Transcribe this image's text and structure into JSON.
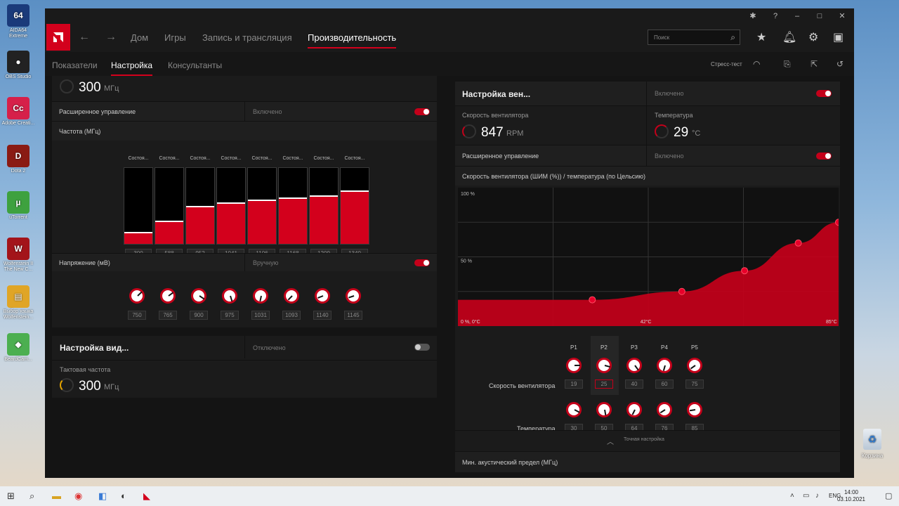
{
  "desktop": {
    "icons": [
      {
        "label": "AIDA64 Extreme",
        "glyph": "64",
        "color": "#1a3a7a"
      },
      {
        "label": "OBS Studio",
        "glyph": "●",
        "color": "#222"
      },
      {
        "label": "Adobe Creati...",
        "glyph": "Cc",
        "color": "#d6204a"
      },
      {
        "label": "Dota 2",
        "glyph": "D",
        "color": "#8a1b14"
      },
      {
        "label": "uTorrent",
        "glyph": "µ",
        "color": "#3ea13f"
      },
      {
        "label": "Wolfenstein II The New C...",
        "glyph": "W",
        "color": "#a3141a"
      },
      {
        "label": "Выбор языка Wolfenstein...",
        "glyph": "▤",
        "color": "#e0a526"
      },
      {
        "label": "BeardCam...",
        "glyph": "◆",
        "color": "#4caf50"
      }
    ],
    "recycle_bin": "Корзина"
  },
  "nav": {
    "items": [
      "Дом",
      "Игры",
      "Запись и трансляция",
      "Производительность"
    ],
    "active_index": 3,
    "search_placeholder": "Поиск"
  },
  "subnav": {
    "items": [
      "Показатели",
      "Настройка",
      "Консультанты"
    ],
    "active_index": 1,
    "stress_test": "Стресс-тест"
  },
  "gpu": {
    "top_clock_value": "300",
    "top_clock_unit": "МГц",
    "advanced_label": "Расширенное управление",
    "advanced_state": "Включено",
    "freq_label": "Частота (МГц)",
    "state_label": "Состоя...",
    "freq_values": [
      300,
      588,
      952,
      1041,
      1106,
      1168,
      1209,
      1340
    ],
    "freq_max": 1900,
    "voltage_label": "Напряжение (мВ)",
    "voltage_state": "Вручную",
    "voltage_values": [
      750,
      765,
      900,
      975,
      1031,
      1093,
      1140,
      1145
    ]
  },
  "vram": {
    "title": "Настройка вид...",
    "state": "Отключено",
    "clock_label": "Тактовая частота",
    "clock_value": "300",
    "clock_unit": "МГц"
  },
  "fan": {
    "title": "Настройка вен...",
    "state": "Включено",
    "speed_label": "Скорость вентилятора",
    "speed_value": "847",
    "speed_unit": "RPM",
    "temp_label": "Температура",
    "temp_value": "29",
    "temp_unit": "°C",
    "advanced_label": "Расширенное управление",
    "advanced_state": "Включено",
    "curve_label": "Скорость вентилятора (ШИМ (%)) / температура (по Цельсию)",
    "fine_tune": "Точная настройка",
    "acoustic_label": "Мин. акустический предел (МГц)",
    "points": [
      "P1",
      "P2",
      "P3",
      "P4",
      "P5"
    ],
    "speed_row_label": "Скорость вентилятора",
    "temp_row_label": "Температура",
    "speeds": [
      19,
      25,
      40,
      60,
      75
    ],
    "temps": [
      30,
      50,
      64,
      76,
      85
    ],
    "selected_index": 1
  },
  "chart_data": {
    "type": "area",
    "x": [
      0,
      30,
      50,
      64,
      76,
      85
    ],
    "values": [
      19,
      19,
      25,
      40,
      60,
      75
    ],
    "ytick_labels": [
      "100 %",
      "50 %",
      "0 %, 0°C"
    ],
    "xtick_labels": [
      "42°C",
      "85°C"
    ],
    "xlim": [
      0,
      85
    ],
    "ylim": [
      0,
      100
    ],
    "color": "#c4001a"
  },
  "taskbar": {
    "lang": "ENG",
    "time": "14:00",
    "date": "03.10.2021"
  }
}
